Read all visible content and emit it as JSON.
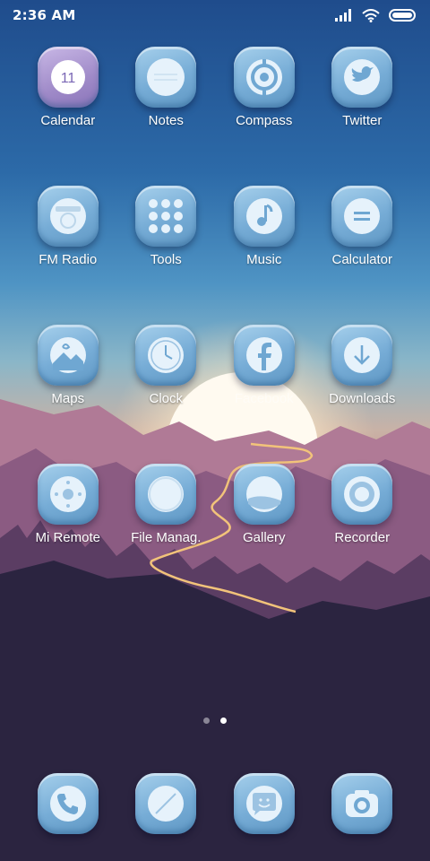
{
  "status_bar": {
    "time": "2:36 AM",
    "icons": [
      "signal-icon",
      "wifi-icon",
      "battery-icon"
    ]
  },
  "apps": [
    {
      "label": "Calendar",
      "icon": "calendar-icon",
      "badge": "11"
    },
    {
      "label": "Notes",
      "icon": "notes-icon"
    },
    {
      "label": "Compass",
      "icon": "compass-icon"
    },
    {
      "label": "Twitter",
      "icon": "twitter-icon"
    },
    {
      "label": "FM Radio",
      "icon": "radio-icon"
    },
    {
      "label": "Tools",
      "icon": "tools-icon"
    },
    {
      "label": "Music",
      "icon": "music-icon"
    },
    {
      "label": "Calculator",
      "icon": "calculator-icon"
    },
    {
      "label": "Maps",
      "icon": "maps-icon"
    },
    {
      "label": "Clock",
      "icon": "clock-icon"
    },
    {
      "label": "Facebook",
      "icon": "facebook-icon"
    },
    {
      "label": "Downloads",
      "icon": "downloads-icon"
    },
    {
      "label": "Mi Remote",
      "icon": "remote-icon"
    },
    {
      "label": "File Manag.",
      "icon": "file-manager-icon"
    },
    {
      "label": "Gallery",
      "icon": "gallery-icon"
    },
    {
      "label": "Recorder",
      "icon": "recorder-icon"
    }
  ],
  "page_indicator": {
    "pages": 2,
    "current": 2
  },
  "dock": [
    {
      "icon": "phone-icon"
    },
    {
      "icon": "browser-icon"
    },
    {
      "icon": "messages-icon"
    },
    {
      "icon": "camera-icon"
    }
  ],
  "colors": {
    "sky_top": "#1f4c8c",
    "sky_mid": "#4f94c4",
    "icon_blue": "#76acd6",
    "mountain": "#8b5b82",
    "valley": "#2b2440"
  }
}
